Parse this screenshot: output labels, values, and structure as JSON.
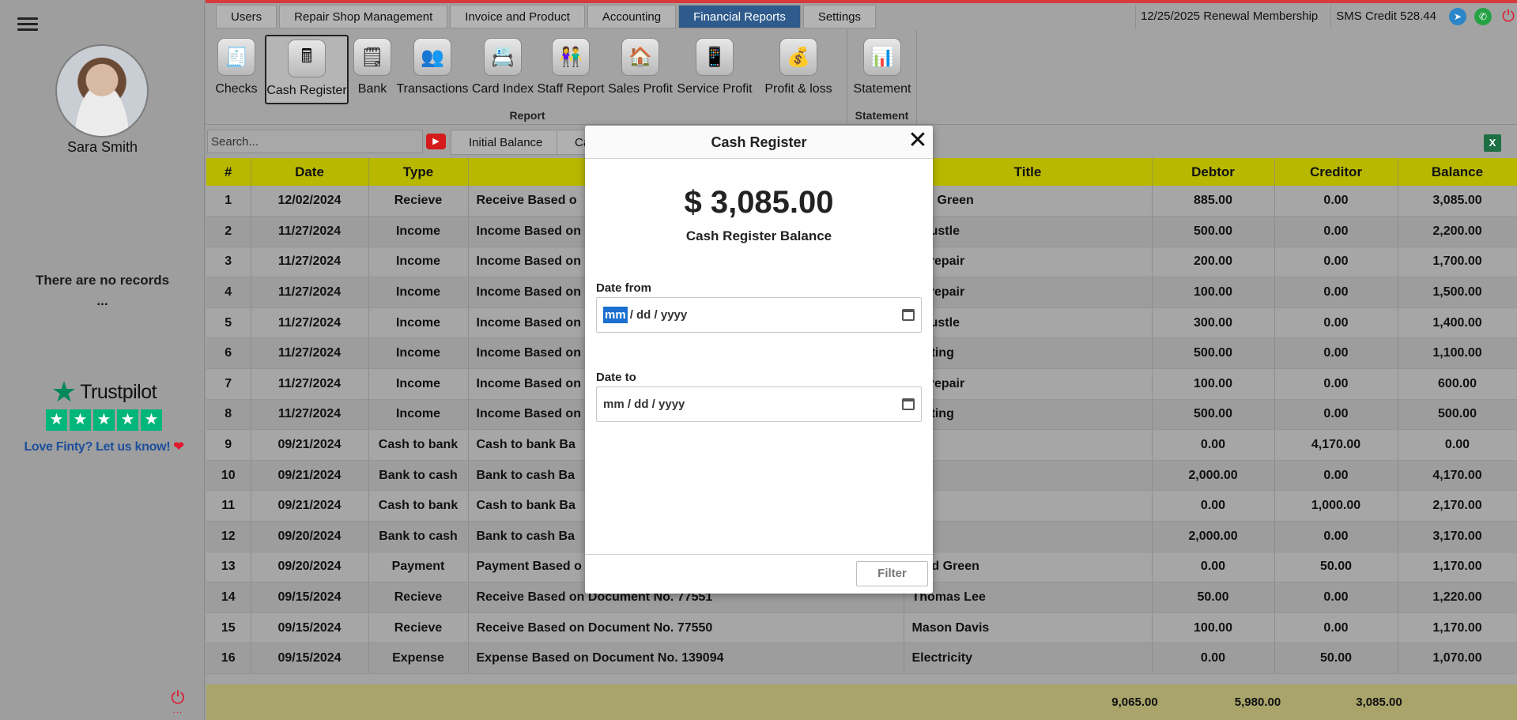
{
  "sidebar": {
    "user_name": "Sara Smith",
    "no_records": "There are no records",
    "no_records_dots": "...",
    "trustpilot_name": "Trustpilot",
    "trustpilot_cta": "Love Finty? Let us know!",
    "power_dots": "..."
  },
  "top_tabs": [
    "Users",
    "Repair Shop Management",
    "Invoice and Product",
    "Accounting",
    "Financial Reports",
    "Settings"
  ],
  "active_tab": "Financial Reports",
  "topbar": {
    "renewal": "12/25/2025 Renewal Membership",
    "sms_credit": "SMS Credit 528.44"
  },
  "ribbon": {
    "report_items": [
      "Checks",
      "Cash Register",
      "Bank",
      "Transactions",
      "Card Index",
      "Staff Report",
      "Sales Profit",
      "Service Profit",
      "Profit & loss"
    ],
    "report_group": "Report",
    "statement_items": [
      "Statement"
    ],
    "statement_group": "Statement",
    "active_item": "Cash Register"
  },
  "search": {
    "placeholder": "Search...",
    "filter_tabs": [
      "Initial Balance",
      "Ca"
    ]
  },
  "table": {
    "headers": [
      "#",
      "Date",
      "Type",
      "",
      "Title",
      "Debtor",
      "Creditor",
      "Balance"
    ],
    "rows": [
      [
        "1",
        "12/02/2024",
        "Recieve",
        "Receive Based o",
        "san Green",
        "885.00",
        "0.00",
        "3,085.00"
      ],
      [
        "2",
        "11/27/2024",
        "Income",
        "Income Based on",
        "e hustle",
        "500.00",
        "0.00",
        "2,200.00"
      ],
      [
        "3",
        "11/27/2024",
        "Income",
        "Income Based on",
        "ck repair",
        "200.00",
        "0.00",
        "1,700.00"
      ],
      [
        "4",
        "11/27/2024",
        "Income",
        "Income Based on",
        "ck repair",
        "100.00",
        "0.00",
        "1,500.00"
      ],
      [
        "5",
        "11/27/2024",
        "Income",
        "Income Based on",
        "e hustle",
        "300.00",
        "0.00",
        "1,400.00"
      ],
      [
        "6",
        "11/27/2024",
        "Income",
        "Income Based on",
        "rketing",
        "500.00",
        "0.00",
        "1,100.00"
      ],
      [
        "7",
        "11/27/2024",
        "Income",
        "Income Based on",
        "ck repair",
        "100.00",
        "0.00",
        "600.00"
      ],
      [
        "8",
        "11/27/2024",
        "Income",
        "Income Based on",
        "rketing",
        "500.00",
        "0.00",
        "500.00"
      ],
      [
        "9",
        "09/21/2024",
        "Cash to bank",
        "Cash to bank Ba",
        "",
        "0.00",
        "4,170.00",
        "0.00"
      ],
      [
        "10",
        "09/21/2024",
        "Bank to cash",
        "Bank to cash Ba",
        "",
        "2,000.00",
        "0.00",
        "4,170.00"
      ],
      [
        "11",
        "09/21/2024",
        "Cash to bank",
        "Cash to bank Ba",
        "",
        "0.00",
        "1,000.00",
        "2,170.00"
      ],
      [
        "12",
        "09/20/2024",
        "Bank to cash",
        "Bank to cash Ba",
        "",
        "2,000.00",
        "0.00",
        "3,170.00"
      ],
      [
        "13",
        "09/20/2024",
        "Payment",
        "Payment Based o",
        "hard Green",
        "0.00",
        "50.00",
        "1,170.00"
      ],
      [
        "14",
        "09/15/2024",
        "Recieve",
        "Receive Based on Document No. 77551",
        "Thomas Lee",
        "50.00",
        "0.00",
        "1,220.00"
      ],
      [
        "15",
        "09/15/2024",
        "Recieve",
        "Receive Based on Document No. 77550",
        "Mason Davis",
        "100.00",
        "0.00",
        "1,170.00"
      ],
      [
        "16",
        "09/15/2024",
        "Expense",
        "Expense Based on Document No. 139094",
        "Electricity",
        "0.00",
        "50.00",
        "1,070.00"
      ]
    ],
    "totals": {
      "debtor": "9,065.00",
      "creditor": "5,980.00",
      "balance": "3,085.00"
    }
  },
  "modal": {
    "title": "Cash Register",
    "amount": "$ 3,085.00",
    "subtitle": "Cash Register Balance",
    "date_from_label": "Date from",
    "date_to_label": "Date to",
    "date_mm": "mm",
    "date_rest": "/ dd / yyyy",
    "date_full": "mm / dd / yyyy",
    "filter_label": "Filter"
  },
  "colors": {
    "accent_tab": "#2f5b8c",
    "header_yellow": "#b8b800",
    "trustpilot_green": "#00b67a",
    "power_red": "#e0182d"
  },
  "icons": {
    "menu": "hamburger-icon",
    "telegram": "telegram-icon",
    "whatsapp": "whatsapp-icon",
    "power": "power-icon",
    "youtube": "youtube-icon",
    "excel": "excel-icon",
    "close": "close-icon",
    "calendar": "calendar-icon"
  }
}
